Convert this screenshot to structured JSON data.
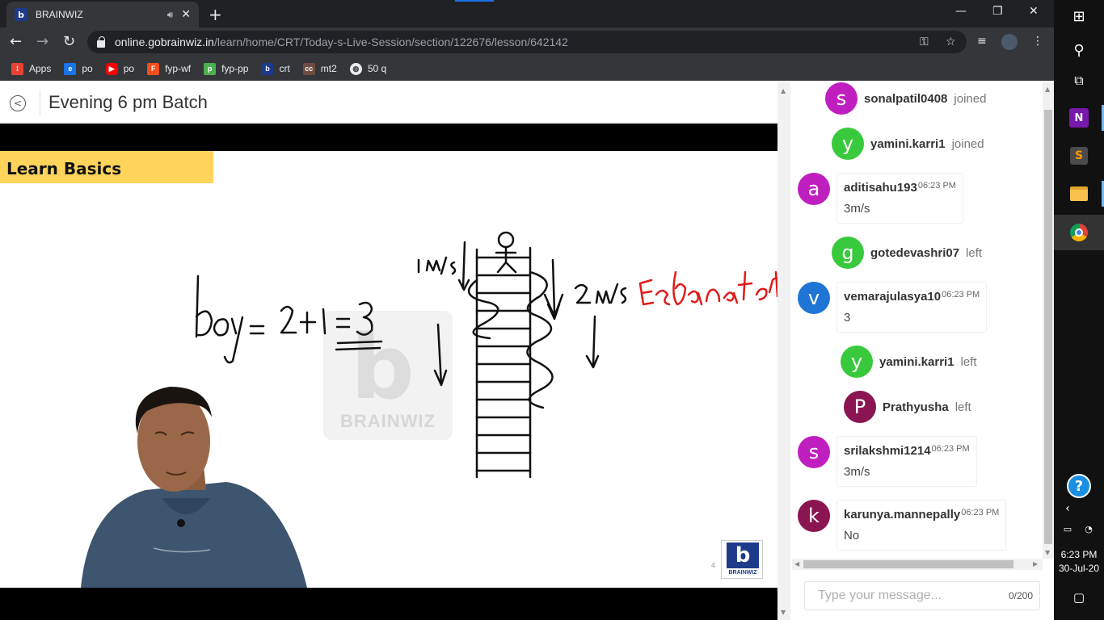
{
  "browser": {
    "tab_title": "BRAINWIZ",
    "tab_favicon_letter": "b",
    "url_domain": "online.gobrainwiz.in",
    "url_path": "/learn/home/CRT/Today-s-Live-Session/section/122676/lesson/642142",
    "bookmarks": [
      {
        "label": "Apps",
        "icon": "apps-grid-icon",
        "color": "#e94235"
      },
      {
        "label": "po",
        "icon": "e-icon",
        "color": "#1a73e8"
      },
      {
        "label": "po",
        "icon": "youtube-icon",
        "color": "#ff0000"
      },
      {
        "label": "fyp-wf",
        "icon": "figma-icon",
        "color": "#f24e1e"
      },
      {
        "label": "fyp-pp",
        "icon": "pdf-icon",
        "color": "#4caf50"
      },
      {
        "label": "crt",
        "icon": "brainwiz-icon",
        "color": "#1e3a8a"
      },
      {
        "label": "mt2",
        "icon": "cc-icon",
        "color": "#6d4c41"
      },
      {
        "label": "50 q",
        "icon": "globe-icon",
        "color": "#5f6368"
      }
    ]
  },
  "page": {
    "title": "Evening 6 pm Batch"
  },
  "slide": {
    "banner": "Learn Basics",
    "watermark": "BRAINWIZ",
    "logo_text": "BRAINWIZ",
    "slide_number": "4"
  },
  "chat": {
    "events": [
      {
        "initial": "s",
        "name": "sonalpatil0408",
        "action": "joined",
        "color": "#c01fc0"
      },
      {
        "initial": "y",
        "name": "yamini.karri1",
        "action": "joined",
        "color": "#39c93d"
      },
      {
        "initial": "g",
        "name": "gotedevashri07",
        "action": "left",
        "color": "#39c93d"
      },
      {
        "initial": "y",
        "name": "yamini.karri1",
        "action": "left",
        "color": "#39c93d"
      },
      {
        "initial": "P",
        "name": "Prathyusha",
        "action": "left",
        "color": "#8b1552"
      }
    ],
    "messages": [
      {
        "initial": "a",
        "user": "aditisahu193",
        "time": "06:23 PM",
        "text": "3m/s",
        "color": "#c01fc0"
      },
      {
        "initial": "v",
        "user": "vemarajulasya10",
        "time": "06:23 PM",
        "text": "3",
        "color": "#1f75d6"
      },
      {
        "initial": "s",
        "user": "srilakshmi1214",
        "time": "06:23 PM",
        "text": "3m/s",
        "color": "#c01fc0"
      },
      {
        "initial": "k",
        "user": "karunya.mannepally",
        "time": "06:23 PM",
        "text": "No",
        "color": "#8b1552"
      }
    ],
    "input_placeholder": "Type your message...",
    "char_count": "0/200"
  },
  "taskbar": {
    "time": "6:23 PM",
    "date": "30-Jul-20"
  }
}
